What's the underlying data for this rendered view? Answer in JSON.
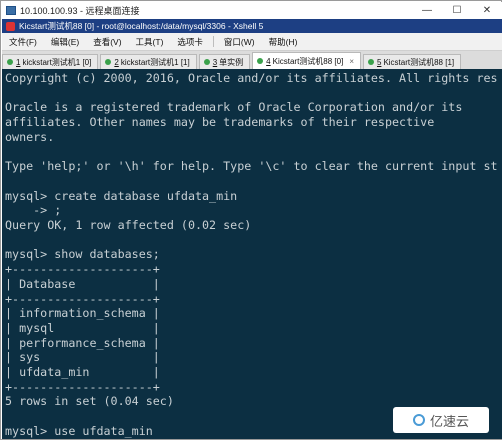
{
  "rdp": {
    "title": "10.100.100.93 - 远程桌面连接",
    "minimize": "—",
    "maximize": "☐",
    "close": "✕"
  },
  "xshell": {
    "title": "Kicstart测试机88 [0] - root@localhost:/data/mysql/3306 - Xshell 5"
  },
  "menu": [
    "文件(F)",
    "编辑(E)",
    "查看(V)",
    "工具(T)",
    "选项卡",
    "窗口(W)",
    "帮助(H)"
  ],
  "tabs": [
    {
      "num": "1",
      "label": "kickstart测试机1 [0]",
      "active": false
    },
    {
      "num": "2",
      "label": "kickstart测试机1 [1]",
      "active": false
    },
    {
      "num": "3",
      "label": "单实例",
      "active": false
    },
    {
      "num": "4",
      "label": "Kicstart测试机88 [0]",
      "active": true
    },
    {
      "num": "5",
      "label": "Kicstart测试机88 [1]",
      "active": false
    }
  ],
  "terminal": {
    "lines": [
      "Copyright (c) 2000, 2016, Oracle and/or its affiliates. All rights res",
      "",
      "Oracle is a registered trademark of Oracle Corporation and/or its",
      "affiliates. Other names may be trademarks of their respective",
      "owners.",
      "",
      "Type 'help;' or '\\h' for help. Type '\\c' to clear the current input st",
      "",
      "mysql> create database ufdata_min",
      "    -> ;",
      "Query OK, 1 row affected (0.02 sec)",
      "",
      "mysql> show databases;",
      "+--------------------+",
      "| Database           |",
      "+--------------------+",
      "| information_schema |",
      "| mysql              |",
      "| performance_schema |",
      "| sys                |",
      "| ufdata_min         |",
      "+--------------------+",
      "5 rows in set (0.04 sec)",
      "",
      "mysql> use ufdata_min"
    ]
  },
  "watermark": {
    "text": "亿速云"
  }
}
